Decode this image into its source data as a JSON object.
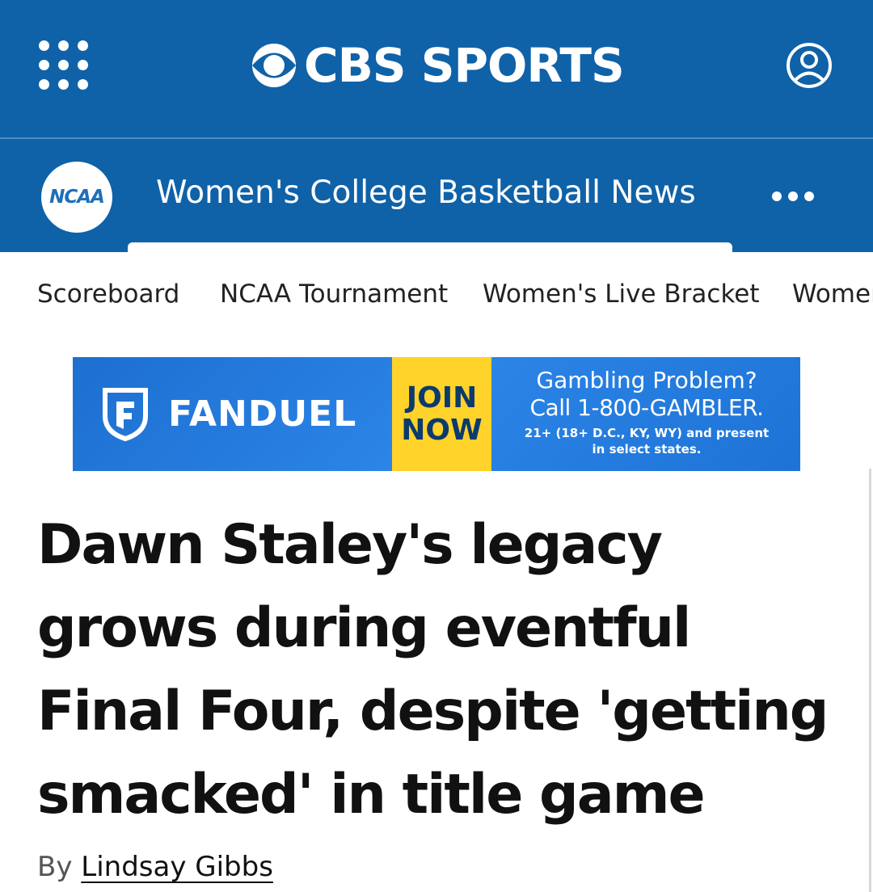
{
  "header": {
    "brand": "CBS SPORTS",
    "menu_icon": "grid-menu-icon",
    "account_icon": "user-account-icon"
  },
  "section": {
    "badge_text": "NCAA",
    "title": "Women's College Basketball News",
    "more_icon": "more-dots-icon"
  },
  "subnav": {
    "items": [
      {
        "label": "Scoreboard"
      },
      {
        "label": "NCAA Tournament"
      },
      {
        "label": "Women's Live Bracket"
      },
      {
        "label": "Women"
      }
    ]
  },
  "ad": {
    "brand": "FANDUEL",
    "cta_line1": "JOIN",
    "cta_line2": "NOW",
    "warning_line1": "Gambling Problem?",
    "warning_line2": "Call 1-800-GAMBLER.",
    "warning_line3": "21+ (18+ D.C., KY, WY) and present",
    "warning_line4": "in select states."
  },
  "article": {
    "headline": "Dawn Staley's legacy grows during eventful Final Four, despite 'getting smacked' in title game",
    "byline_prefix": "By",
    "author": "Lindsay Gibbs"
  },
  "colors": {
    "header_blue": "#0f62a8",
    "ad_cta_yellow": "#ffd329",
    "ad_blue": "#1d6fd0"
  }
}
